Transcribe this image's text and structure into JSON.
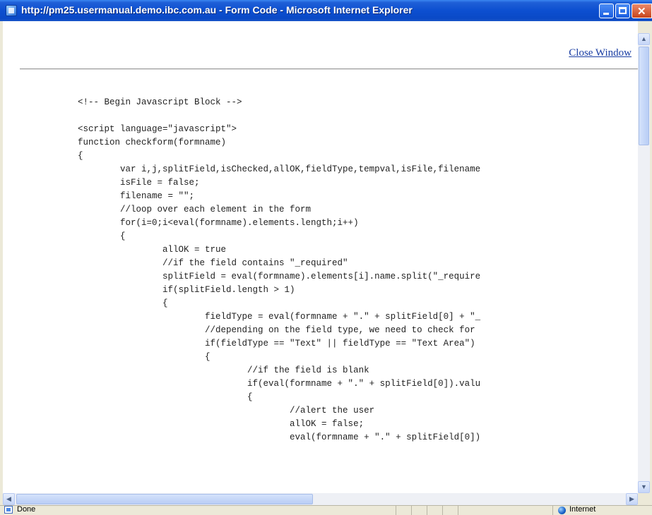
{
  "window": {
    "title": "http://pm25.usermanual.demo.ibc.com.au - Form Code - Microsoft Internet Explorer",
    "controls": [
      "minimize",
      "maximize",
      "close"
    ],
    "icons": {
      "title": "ie-page-icon",
      "minimize": "minimize-icon",
      "maximize": "maximize-icon",
      "close": "close-icon"
    }
  },
  "page": {
    "close_link": "Close Window",
    "code": "<!-- Begin Javascript Block -->\n\n<script language=\"javascript\">\nfunction checkform(formname)\n{\n        var i,j,splitField,isChecked,allOK,fieldType,tempval,isFile,filename\n        isFile = false;\n        filename = \"\";\n        //loop over each element in the form\n        for(i=0;i<eval(formname).elements.length;i++)\n        {\n                allOK = true\n                //if the field contains \"_required\"\n                splitField = eval(formname).elements[i].name.split(\"_require\n                if(splitField.length > 1)\n                {\n                        fieldType = eval(formname + \".\" + splitField[0] + \"_\n                        //depending on the field type, we need to check for\n                        if(fieldType == \"Text\" || fieldType == \"Text Area\")\n                        {\n                                //if the field is blank\n                                if(eval(formname + \".\" + splitField[0]).valu\n                                {\n                                        //alert the user\n                                        allOK = false;\n                                        eval(formname + \".\" + splitField[0])"
  },
  "scrollbars": {
    "up": "▲",
    "down": "▼",
    "left": "◀",
    "right": "▶"
  },
  "status": {
    "text": "Done",
    "zone": "Internet",
    "icons": {
      "done": "ie-page-icon",
      "zone": "globe-icon"
    }
  },
  "colors": {
    "title_bar": "#0c4fd0",
    "link": "#1a3ea3",
    "chrome": "#ece9d8"
  }
}
